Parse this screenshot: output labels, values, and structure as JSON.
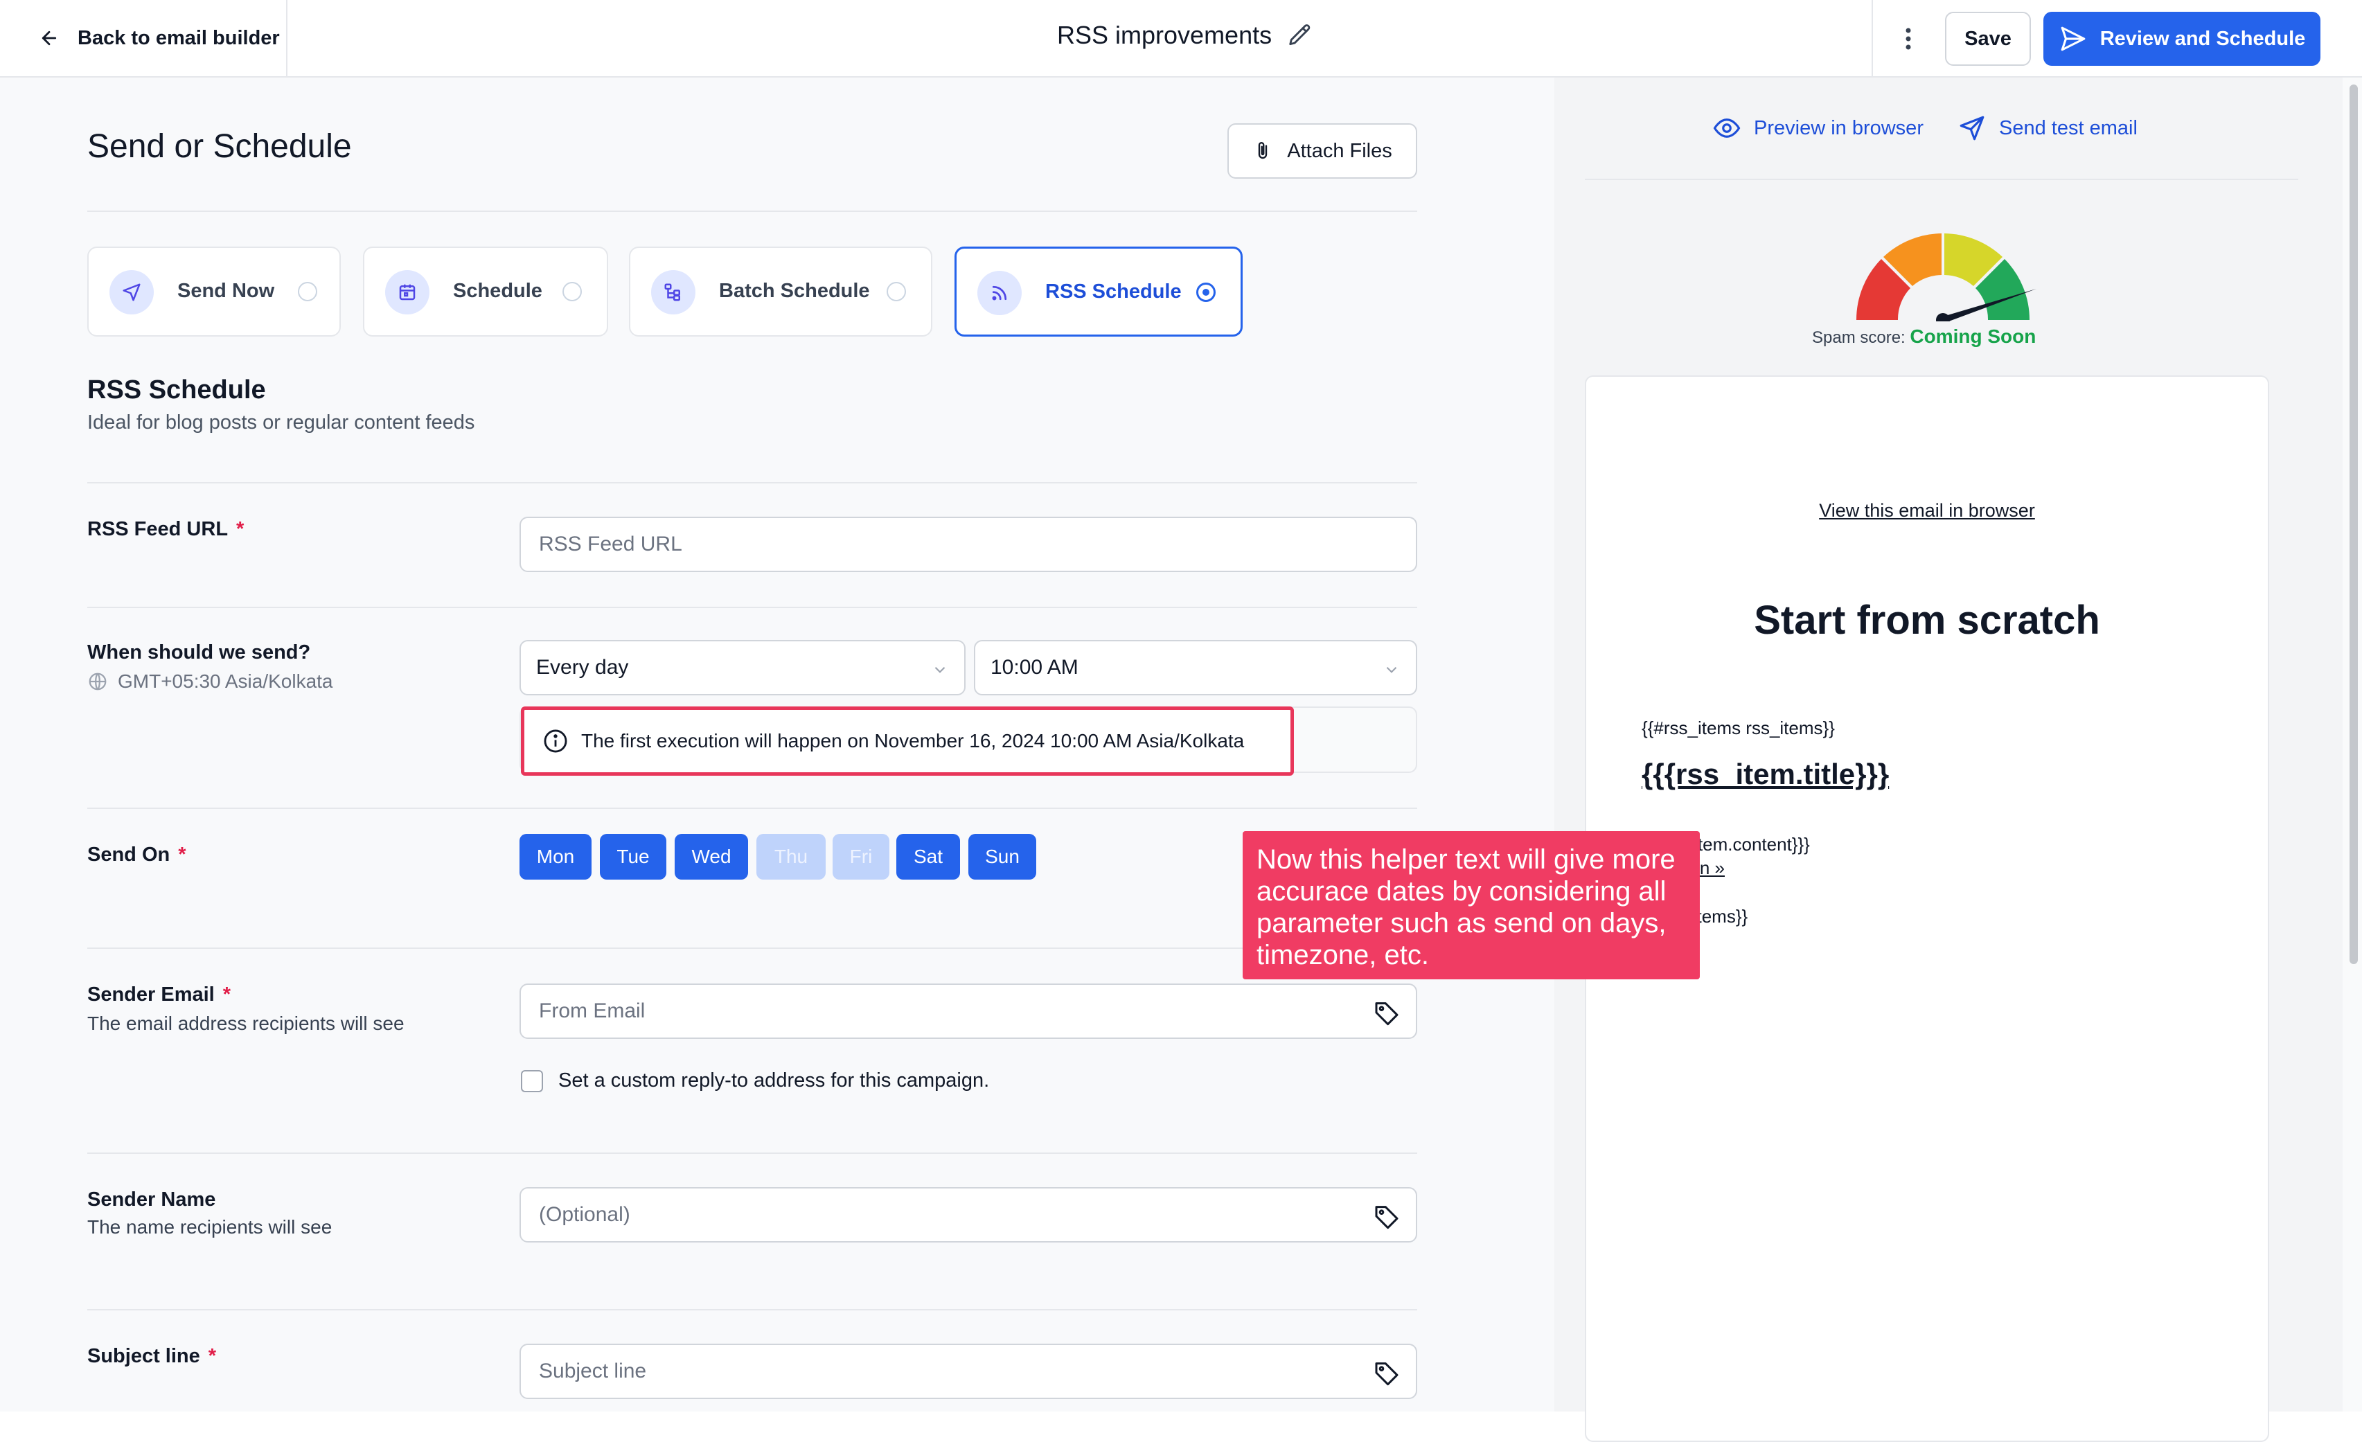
{
  "topbar": {
    "back_label": "Back to email builder",
    "title": "RSS improvements",
    "save_label": "Save",
    "review_label": "Review and Schedule"
  },
  "main": {
    "page_title": "Send or Schedule",
    "attach_label": "Attach Files",
    "modes": [
      {
        "label": "Send Now",
        "icon": "send-icon",
        "selected": false
      },
      {
        "label": "Schedule",
        "icon": "calendar-icon",
        "selected": false
      },
      {
        "label": "Batch Schedule",
        "icon": "batch-icon",
        "selected": false
      },
      {
        "label": "RSS Schedule",
        "icon": "rss-icon",
        "selected": true
      }
    ],
    "section_title": "RSS Schedule",
    "section_sub": "Ideal for blog posts or regular content feeds"
  },
  "form": {
    "rss_url_label": "RSS Feed URL",
    "rss_url_placeholder": "RSS Feed URL",
    "when_label": "When should we send?",
    "timezone": "GMT+05:30 Asia/Kolkata",
    "frequency_value": "Every day",
    "time_value": "10:00 AM",
    "info_text": "The first execution will happen on November 16, 2024 10:00 AM Asia/Kolkata",
    "send_on_label": "Send On",
    "days": [
      {
        "label": "Mon",
        "on": true
      },
      {
        "label": "Tue",
        "on": true
      },
      {
        "label": "Wed",
        "on": true
      },
      {
        "label": "Thu",
        "on": false
      },
      {
        "label": "Fri",
        "on": false
      },
      {
        "label": "Sat",
        "on": true
      },
      {
        "label": "Sun",
        "on": true
      }
    ],
    "sender_email_label": "Sender Email",
    "sender_email_sub": "The email address recipients will see",
    "sender_email_placeholder": "From Email",
    "reply_to_label": "Set a custom reply-to address for this campaign.",
    "sender_name_label": "Sender Name",
    "sender_name_sub": "The name recipients will see",
    "sender_name_placeholder": "(Optional)",
    "subject_label": "Subject line",
    "subject_placeholder": "Subject line",
    "required_mark": "*"
  },
  "callout": {
    "text": "Now this helper text will give more accurace dates by considering all parameter such as send on days, timezone, etc."
  },
  "preview": {
    "preview_browser": "Preview in browser",
    "send_test": "Send test email",
    "spam_label": "Spam score:",
    "spam_value": "Coming Soon",
    "view_in_browser": "View this email in browser",
    "heading": "Start from scratch",
    "line1": "{{#rss_items rss_items}}",
    "item_title": "{{{rss_item.title}}}",
    "line3": "{{{rss_item.content}}}",
    "read_on": "Read on »",
    "line5": "{{/rss_items}}"
  },
  "colors": {
    "primary": "#2563eb",
    "callout": "#f03c63",
    "highlight_border": "#e8365a",
    "spam_value": "#16a34a"
  }
}
